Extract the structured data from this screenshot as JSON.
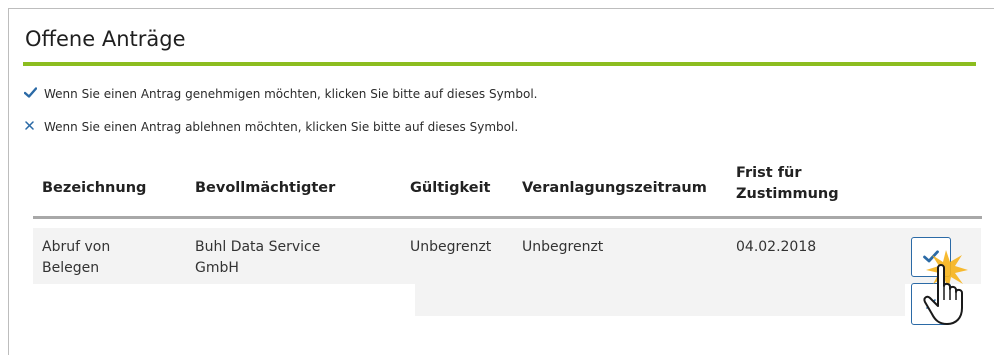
{
  "panel": {
    "title": "Offene Anträge"
  },
  "info": {
    "approve_text": "Wenn Sie einen Antrag genehmigen möchten, klicken Sie bitte auf dieses Symbol.",
    "reject_text": "Wenn Sie einen Antrag ablehnen möchten, klicken Sie bitte auf dieses Symbol."
  },
  "table": {
    "headers": {
      "bezeichnung": "Bezeichnung",
      "bevollmaechtigter": "Bevollmächtigter",
      "gueltigkeit": "Gültigkeit",
      "veranlagungszeitraum": "Veranlagungszeitraum",
      "frist_line1": "Frist für",
      "frist_line2": "Zustimmung"
    },
    "rows": [
      {
        "bezeichnung_line1": "Abruf von",
        "bezeichnung_line2": "Belegen",
        "bevollmaechtigter_line1": "Buhl Data Service",
        "bevollmaechtigter_line2": "GmbH",
        "gueltigkeit": "Unbegrenzt",
        "veranlagungszeitraum": "Unbegrenzt",
        "frist": "04.02.2018"
      }
    ]
  },
  "icons": {
    "approve": "checkmark-icon",
    "reject": "close-icon",
    "cursor": "hand-pointer-icon"
  },
  "colors": {
    "accent_green": "#8cbd1f",
    "icon_blue": "#2b6aa6",
    "highlight": "#f6b21a"
  }
}
